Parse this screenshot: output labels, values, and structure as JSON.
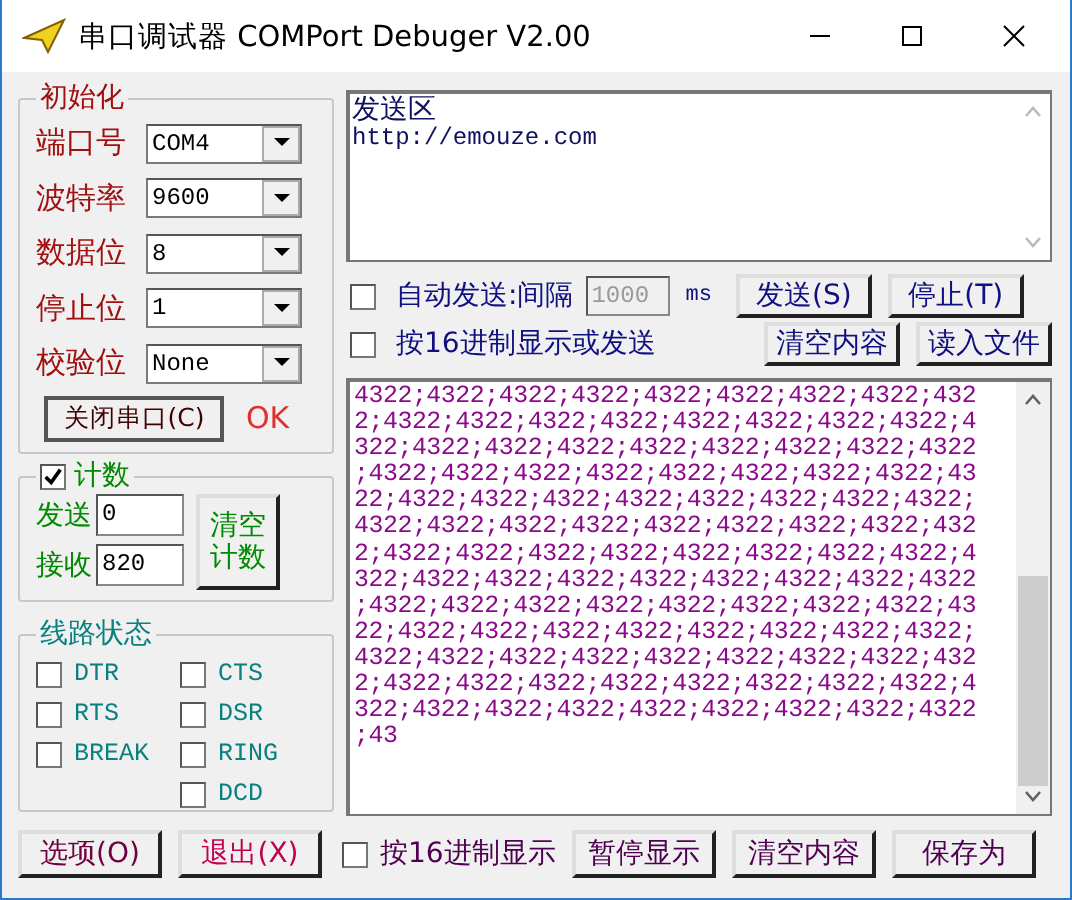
{
  "window": {
    "title": "串口调试器 COMPort Debuger V2.00"
  },
  "init": {
    "title": "初始化",
    "fields": [
      {
        "label": "端口号",
        "value": "COM4"
      },
      {
        "label": "波特率",
        "value": "9600"
      },
      {
        "label": "数据位",
        "value": "8"
      },
      {
        "label": "停止位",
        "value": "1"
      },
      {
        "label": "校验位",
        "value": "None"
      }
    ],
    "port_button": "关闭串口(C)",
    "status": "OK"
  },
  "count": {
    "title": "计数",
    "checked": true,
    "fields": [
      {
        "label": "发送",
        "value": "0"
      },
      {
        "label": "接收",
        "value": "820"
      }
    ],
    "clear_button": "清空计数"
  },
  "line_status": {
    "title": "线路状态",
    "left": [
      {
        "label": "DTR",
        "checked": false
      },
      {
        "label": "RTS",
        "checked": false
      },
      {
        "label": "BREAK",
        "checked": false
      }
    ],
    "right": [
      {
        "label": "CTS",
        "checked": false
      },
      {
        "label": "DSR",
        "checked": false
      },
      {
        "label": "RING",
        "checked": false
      },
      {
        "label": "DCD",
        "checked": false
      }
    ]
  },
  "send": {
    "lines": [
      "发送区",
      "http://emouze.com"
    ],
    "auto_send": {
      "label": "自动发送:间隔",
      "checked": false,
      "interval": "1000",
      "disabled": true,
      "unit": "ms"
    },
    "hex_send": {
      "label": "按16进制显示或发送",
      "checked": false
    },
    "buttons": [
      "发送(S)",
      "停止(T)",
      "清空内容",
      "读入文件"
    ]
  },
  "receive": {
    "lines": [
      "4322;4322;4322;4322;4322;4322;4322;4322;432",
      "2;4322;4322;4322;4322;4322;4322;4322;4322;4",
      "322;4322;4322;4322;4322;4322;4322;4322;4322",
      ";4322;4322;4322;4322;4322;4322;4322;4322;43",
      "22;4322;4322;4322;4322;4322;4322;4322;4322;",
      "4322;4322;4322;4322;4322;4322;4322;4322;432",
      "2;4322;4322;4322;4322;4322;4322;4322;4322;4",
      "322;4322;4322;4322;4322;4322;4322;4322;4322",
      ";4322;4322;4322;4322;4322;4322;4322;4322;43",
      "22;4322;4322;4322;4322;4322;4322;4322;4322;",
      "4322;4322;4322;4322;4322;4322;4322;4322;432",
      "2;4322;4322;4322;4322;4322;4322;4322;4322;4",
      "322;4322;4322;4322;4322;4322;4322;4322;4322",
      ";43"
    ]
  },
  "bottom": {
    "buttons_left": [
      "选项(O)",
      "退出(X)"
    ],
    "hex_display": {
      "label": "按16进制显示",
      "checked": false
    },
    "buttons_right": [
      "暂停显示",
      "清空内容",
      "保存为"
    ]
  }
}
